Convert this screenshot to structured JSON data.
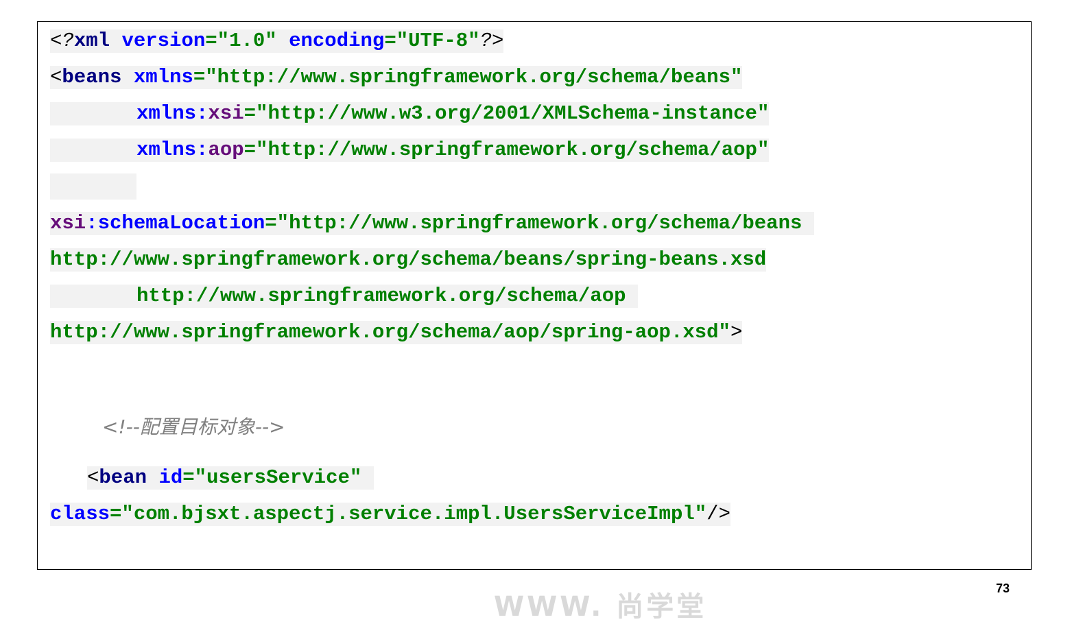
{
  "code": {
    "line1": {
      "pi_open": "<?",
      "decl": "xml",
      "a1": "version",
      "a1v": "=\"1.0\"",
      "a2": "encoding",
      "a2v": "=\"UTF-8\"",
      "pi_close": "?>"
    },
    "line2": {
      "lt": "<",
      "tag": "beans",
      "attr": "xmlns",
      "val": "=\"http://www.springframework.org/schema/beans\""
    },
    "line3": {
      "prefix": "xmlns",
      "colon": ":",
      "ns": "xsi",
      "val": "=\"http://www.w3.org/2001/XMLSchema-instance\""
    },
    "line4": {
      "prefix": "xmlns",
      "colon": ":",
      "ns": "aop",
      "val": "=\"http://www.springframework.org/schema/aop\""
    },
    "line6": {
      "ns": "xsi",
      "colon": ":",
      "attr": "schemaLocation",
      "val": "=\"http://www.springframework.org/schema/beans"
    },
    "line7": {
      "val": "http://www.springframework.org/schema/beans/spring-beans.xsd"
    },
    "line8": {
      "val": "http://www.springframework.org/schema/aop"
    },
    "line9": {
      "val": "http://www.springframework.org/schema/aop/spring-aop.xsd\"",
      "gt": ">"
    },
    "comment": "<!--配置目标对象-->",
    "line11": {
      "lt": "<",
      "tag": "bean",
      "attr": "id",
      "val": "=\"usersService\""
    },
    "line12": {
      "attr": "class",
      "val": "=\"com.bjsxt.aspectj.service.impl.UsersServiceImpl\"",
      "close": "/>"
    }
  },
  "footer": {
    "watermark": "WWW. 尚学堂",
    "page_number": "73"
  }
}
